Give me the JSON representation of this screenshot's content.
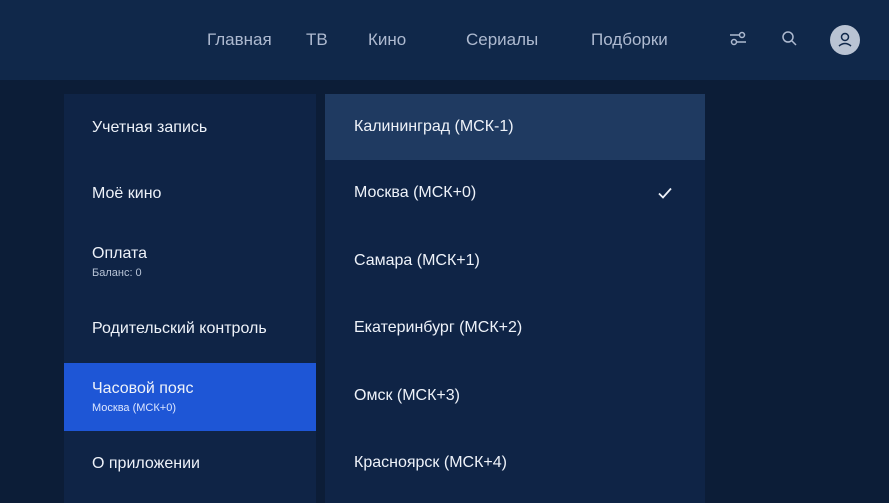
{
  "nav": {
    "items": [
      {
        "label": "Главная"
      },
      {
        "label": "ТВ"
      },
      {
        "label": "Кино"
      },
      {
        "label": "Сериалы"
      },
      {
        "label": "Подборки"
      }
    ],
    "icons": [
      "filter-icon",
      "search-icon",
      "user-icon"
    ]
  },
  "settings_menu": {
    "items": [
      {
        "label": "Учетная запись"
      },
      {
        "label": "Моё кино"
      },
      {
        "label": "Оплата",
        "sub": "Баланс: 0"
      },
      {
        "label": "Родительский контроль"
      },
      {
        "label": "Часовой пояс",
        "sub": "Москва (МСК+0)",
        "active": true
      },
      {
        "label": "О приложении"
      }
    ]
  },
  "timezones": {
    "items": [
      {
        "label": "Калининград (МСК-1)",
        "focused": true
      },
      {
        "label": "Москва (МСК+0)",
        "selected": true
      },
      {
        "label": "Самара (МСК+1)"
      },
      {
        "label": "Екатеринбург (МСК+2)"
      },
      {
        "label": "Омск (МСК+3)"
      },
      {
        "label": "Красноярск (МСК+4)"
      }
    ]
  },
  "colors": {
    "background": "#0c1d37",
    "topbar": "#10284a",
    "panel": "#0f2446",
    "accent": "#1e56d6",
    "focus": "#1f3a61"
  }
}
